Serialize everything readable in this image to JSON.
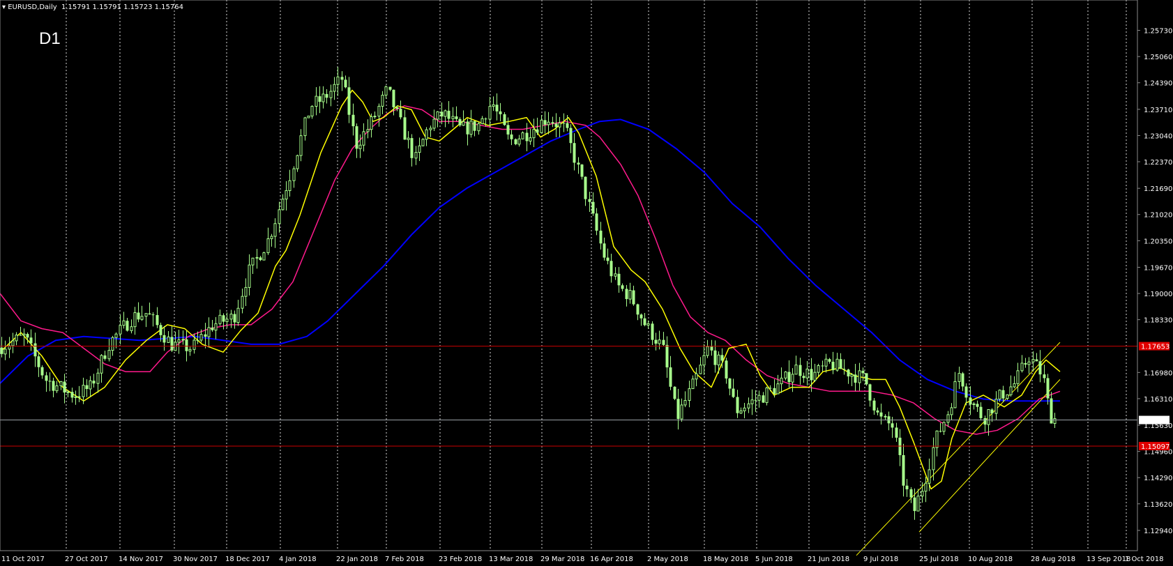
{
  "header": {
    "symbol": "EURUSD,Daily",
    "ohlc": "1.15791 1.15791 1.15723 1.15764",
    "timeframe_label": "D1"
  },
  "chart_data": {
    "type": "candlestick",
    "symbol": "EURUSD",
    "period": "Daily",
    "ylim": [
      1.126,
      1.2615
    ],
    "y_ticks": [
      "1.25730",
      "1.25060",
      "1.24390",
      "1.23710",
      "1.23040",
      "1.22370",
      "1.21690",
      "1.21020",
      "1.20350",
      "1.19670",
      "1.19000",
      "1.18330",
      "1.16980",
      "1.16310",
      "1.15630",
      "1.14960",
      "1.14290",
      "1.13620",
      "1.12940"
    ],
    "x_labels": [
      "11 Oct 2017",
      "27 Oct 2017",
      "14 Nov 2017",
      "30 Nov 2017",
      "18 Dec 2017",
      "4 Jan 2018",
      "22 Jan 2018",
      "7 Feb 2018",
      "23 Feb 2018",
      "13 Mar 2018",
      "29 Mar 2018",
      "16 Apr 2018",
      "2 May 2018",
      "18 May 2018",
      "5 Jun 2018",
      "21 Jun 2018",
      "9 Jul 2018",
      "25 Jul 2018",
      "10 Aug 2018",
      "28 Aug 2018",
      "13 Sep 2018",
      "1 Oct 2018"
    ],
    "grid": "vertical dotted",
    "series_colors": {
      "candles": "#a8ff8c",
      "fast_ma": "#ffff00",
      "mid_ma": "#ff1a8c",
      "slow_ma": "#0000ff",
      "levels": "#cc0000",
      "current": "#9aa0a6",
      "channel": "#ffff00"
    },
    "fast_ma": [
      [
        0,
        1.175
      ],
      [
        30,
        1.18
      ],
      [
        60,
        1.174
      ],
      [
        90,
        1.166
      ],
      [
        120,
        1.1625
      ],
      [
        150,
        1.166
      ],
      [
        180,
        1.173
      ],
      [
        210,
        1.178
      ],
      [
        240,
        1.182
      ],
      [
        265,
        1.181
      ],
      [
        290,
        1.177
      ],
      [
        320,
        1.175
      ],
      [
        345,
        1.1805
      ],
      [
        370,
        1.185
      ],
      [
        395,
        1.197
      ],
      [
        410,
        1.201
      ],
      [
        430,
        1.21
      ],
      [
        460,
        1.226
      ],
      [
        490,
        1.238
      ],
      [
        505,
        1.242
      ],
      [
        520,
        1.239
      ],
      [
        535,
        1.234
      ],
      [
        550,
        1.235
      ],
      [
        570,
        1.238
      ],
      [
        590,
        1.237
      ],
      [
        610,
        1.23
      ],
      [
        630,
        1.229
      ],
      [
        650,
        1.232
      ],
      [
        670,
        1.235
      ],
      [
        700,
        1.233
      ],
      [
        730,
        1.234
      ],
      [
        755,
        1.235
      ],
      [
        775,
        1.23
      ],
      [
        795,
        1.232
      ],
      [
        815,
        1.235
      ],
      [
        830,
        1.231
      ],
      [
        855,
        1.22
      ],
      [
        880,
        1.202
      ],
      [
        905,
        1.196
      ],
      [
        925,
        1.193
      ],
      [
        950,
        1.186
      ],
      [
        975,
        1.176
      ],
      [
        995,
        1.17
      ],
      [
        1020,
        1.166
      ],
      [
        1045,
        1.176
      ],
      [
        1070,
        1.177
      ],
      [
        1090,
        1.169
      ],
      [
        1110,
        1.164
      ],
      [
        1135,
        1.166
      ],
      [
        1160,
        1.166
      ],
      [
        1180,
        1.17
      ],
      [
        1205,
        1.171
      ],
      [
        1225,
        1.169
      ],
      [
        1250,
        1.168
      ],
      [
        1270,
        1.168
      ],
      [
        1290,
        1.161
      ],
      [
        1310,
        1.152
      ],
      [
        1335,
        1.14
      ],
      [
        1350,
        1.142
      ],
      [
        1365,
        1.153
      ],
      [
        1385,
        1.162
      ],
      [
        1410,
        1.164
      ],
      [
        1440,
        1.161
      ],
      [
        1465,
        1.164
      ],
      [
        1485,
        1.17
      ],
      [
        1500,
        1.173
      ],
      [
        1520,
        1.17
      ]
    ],
    "mid_ma": [
      [
        0,
        1.19
      ],
      [
        30,
        1.183
      ],
      [
        60,
        1.181
      ],
      [
        90,
        1.18
      ],
      [
        120,
        1.176
      ],
      [
        150,
        1.172
      ],
      [
        180,
        1.17
      ],
      [
        215,
        1.17
      ],
      [
        240,
        1.175
      ],
      [
        270,
        1.179
      ],
      [
        300,
        1.181
      ],
      [
        330,
        1.182
      ],
      [
        360,
        1.182
      ],
      [
        390,
        1.186
      ],
      [
        420,
        1.193
      ],
      [
        450,
        1.206
      ],
      [
        480,
        1.219
      ],
      [
        505,
        1.227
      ],
      [
        530,
        1.232
      ],
      [
        555,
        1.236
      ],
      [
        580,
        1.238
      ],
      [
        605,
        1.237
      ],
      [
        630,
        1.234
      ],
      [
        660,
        1.234
      ],
      [
        690,
        1.233
      ],
      [
        720,
        1.232
      ],
      [
        750,
        1.232
      ],
      [
        780,
        1.233
      ],
      [
        810,
        1.234
      ],
      [
        840,
        1.233
      ],
      [
        860,
        1.23
      ],
      [
        890,
        1.223
      ],
      [
        915,
        1.215
      ],
      [
        940,
        1.204
      ],
      [
        965,
        1.192
      ],
      [
        990,
        1.184
      ],
      [
        1015,
        1.18
      ],
      [
        1040,
        1.178
      ],
      [
        1070,
        1.173
      ],
      [
        1100,
        1.169
      ],
      [
        1130,
        1.167
      ],
      [
        1160,
        1.166
      ],
      [
        1190,
        1.165
      ],
      [
        1220,
        1.165
      ],
      [
        1250,
        1.165
      ],
      [
        1280,
        1.164
      ],
      [
        1310,
        1.162
      ],
      [
        1340,
        1.158
      ],
      [
        1370,
        1.155
      ],
      [
        1400,
        1.154
      ],
      [
        1430,
        1.155
      ],
      [
        1460,
        1.158
      ],
      [
        1490,
        1.163
      ],
      [
        1520,
        1.165
      ]
    ],
    "slow_ma": [
      [
        0,
        1.167
      ],
      [
        40,
        1.174
      ],
      [
        80,
        1.178
      ],
      [
        120,
        1.179
      ],
      [
        160,
        1.1785
      ],
      [
        200,
        1.178
      ],
      [
        240,
        1.1785
      ],
      [
        280,
        1.179
      ],
      [
        320,
        1.178
      ],
      [
        360,
        1.177
      ],
      [
        400,
        1.177
      ],
      [
        440,
        1.179
      ],
      [
        470,
        1.183
      ],
      [
        510,
        1.19
      ],
      [
        550,
        1.197
      ],
      [
        590,
        1.205
      ],
      [
        630,
        1.212
      ],
      [
        670,
        1.217
      ],
      [
        710,
        1.221
      ],
      [
        750,
        1.225
      ],
      [
        790,
        1.229
      ],
      [
        830,
        1.232
      ],
      [
        860,
        1.234
      ],
      [
        890,
        1.2345
      ],
      [
        930,
        1.232
      ],
      [
        970,
        1.227
      ],
      [
        1010,
        1.221
      ],
      [
        1050,
        1.213
      ],
      [
        1090,
        1.207
      ],
      [
        1130,
        1.199
      ],
      [
        1170,
        1.192
      ],
      [
        1210,
        1.186
      ],
      [
        1250,
        1.18
      ],
      [
        1290,
        1.173
      ],
      [
        1330,
        1.168
      ],
      [
        1370,
        1.165
      ],
      [
        1410,
        1.163
      ],
      [
        1450,
        1.1625
      ],
      [
        1490,
        1.1625
      ],
      [
        1520,
        1.1625
      ]
    ],
    "level_high": "1.17653",
    "level_low": "1.15097",
    "current_price": "1.15764",
    "channel_lower": [
      [
        1228,
        1.123
      ],
      [
        1520,
        1.1775
      ]
    ],
    "channel_upper": [
      [
        1318,
        1.129
      ],
      [
        1520,
        1.168
      ]
    ]
  }
}
